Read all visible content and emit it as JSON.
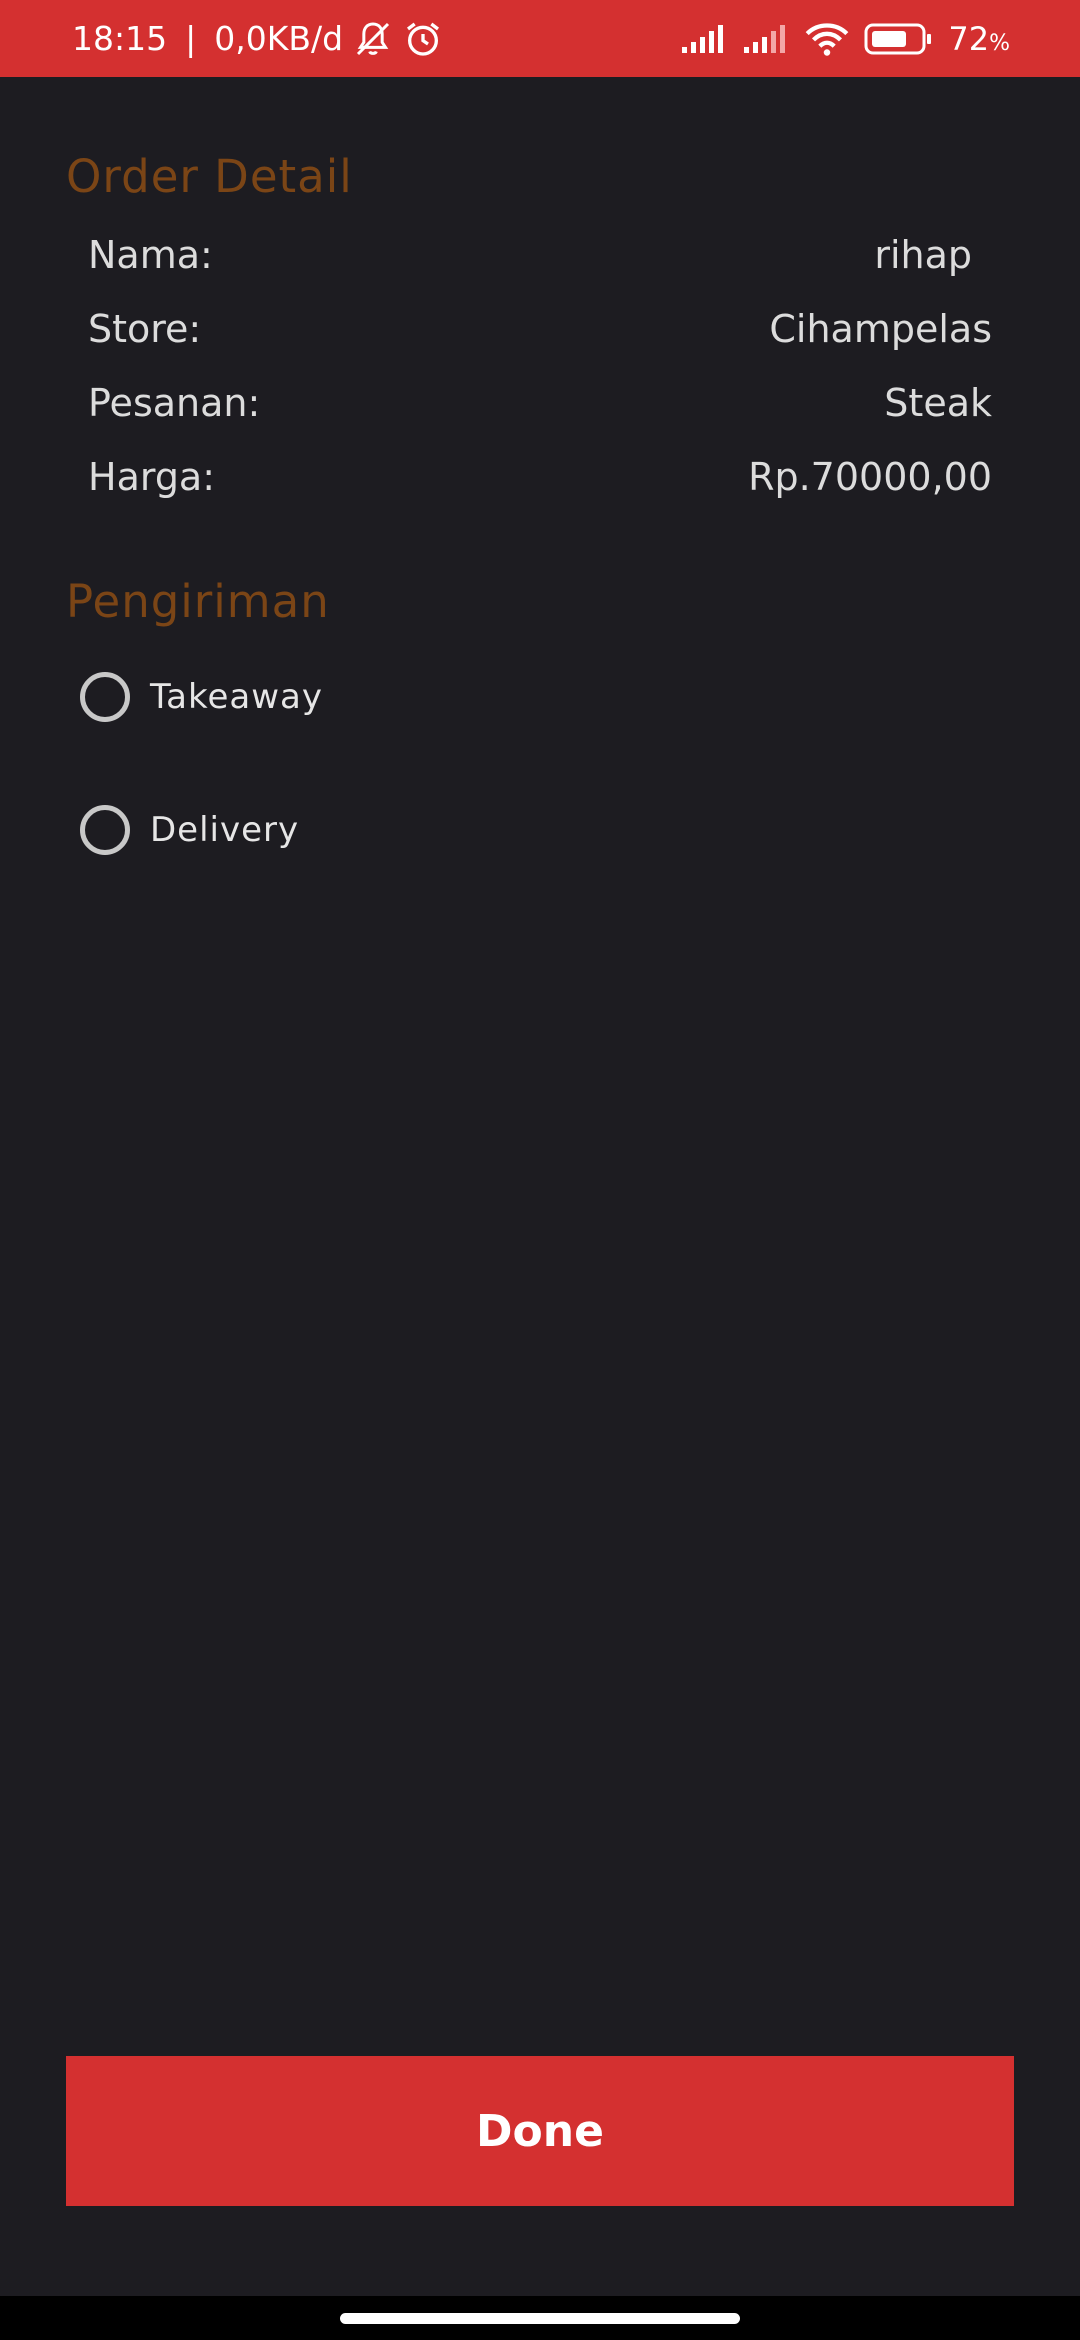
{
  "status_bar": {
    "time": "18:15",
    "separator": "|",
    "network_speed": "0,0KB/d",
    "battery_percent": "72",
    "battery_unit": "%",
    "icons": [
      "bell-off-icon",
      "alarm-icon",
      "signal-icon",
      "signal-icon",
      "wifi-icon",
      "battery-icon"
    ],
    "background_color": "#d43030"
  },
  "order_detail": {
    "title": "Order Detail",
    "rows": [
      {
        "label": "Nama:",
        "value": "rihap"
      },
      {
        "label": "Store:",
        "value": "Cihampelas"
      },
      {
        "label": "Pesanan:",
        "value": "Steak"
      },
      {
        "label": "Harga:",
        "value": "Rp.70000,00"
      }
    ]
  },
  "pengiriman": {
    "title": "Pengiriman",
    "options": [
      {
        "label": "Takeaway",
        "selected": false
      },
      {
        "label": "Delivery",
        "selected": false
      }
    ]
  },
  "done_button": {
    "label": "Done",
    "color": "#d43030"
  },
  "colors": {
    "background": "#1d1c21",
    "section_title": "#7b4516",
    "text": "#dcdcdc"
  }
}
